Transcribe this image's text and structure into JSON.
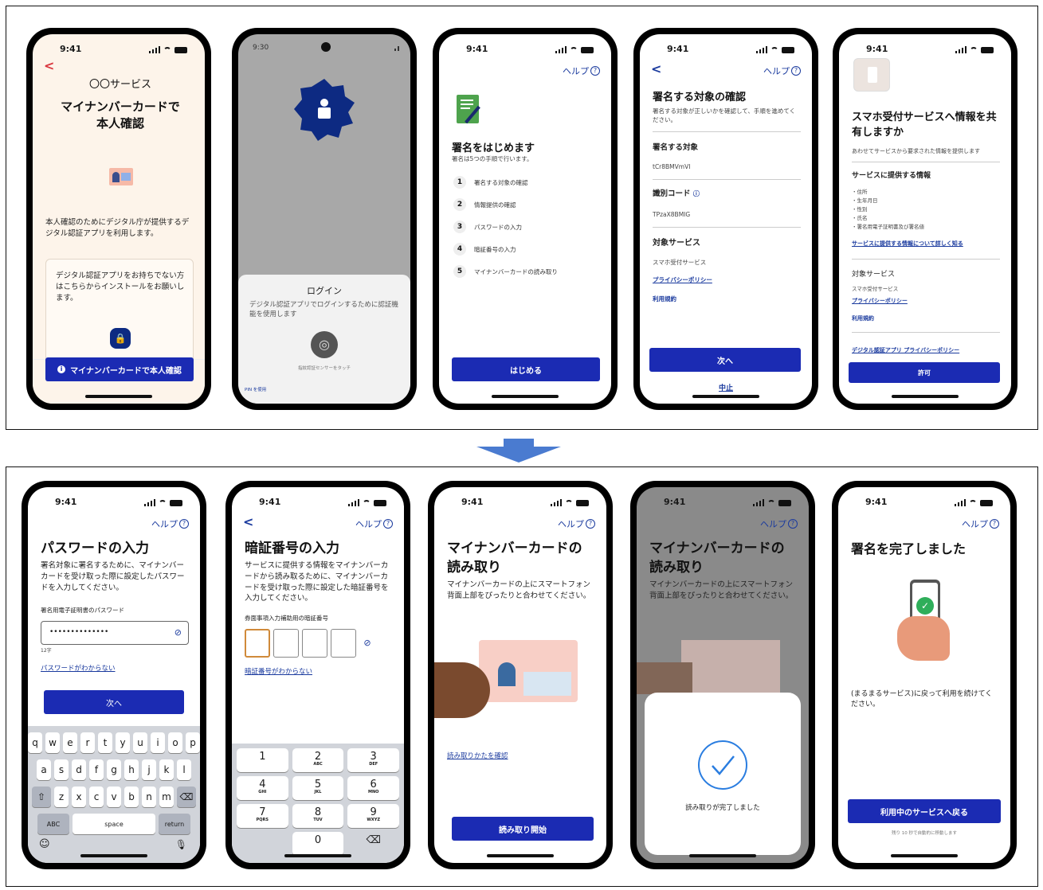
{
  "colors": {
    "primary": "#1b2bb3",
    "arrow": "#4a7bd0"
  },
  "s1": {
    "time": "9:41",
    "back": "<",
    "service": "〇〇サービス",
    "title_l1": "マイナンバーカードで",
    "title_l2": "本人確認",
    "desc": "本人確認のためにデジタル庁が提供するデジタル認証アプリを利用します。",
    "install_text": "デジタル認証アプリをお持ちでない方はこちらからインストールをお願いします。",
    "button": "マイナンバーカードで本人確認"
  },
  "s2": {
    "time": "9:30",
    "sheet_title": "ログイン",
    "sheet_desc": "デジタル認証アプリでログインするために認証機能を使用します",
    "sensor_text": "指紋認証センサーをタッチ",
    "pin": "PIN を使用"
  },
  "s3": {
    "time": "9:41",
    "help": "ヘルプ",
    "title": "署名をはじめます",
    "subtitle": "署名は5つの手順で行います。",
    "steps": [
      {
        "n": "1",
        "label": "署名する対象の確認"
      },
      {
        "n": "2",
        "label": "情報提供の確認"
      },
      {
        "n": "3",
        "label": "パスワードの入力"
      },
      {
        "n": "4",
        "label": "暗証番号の入力"
      },
      {
        "n": "5",
        "label": "マイナンバーカードの読み取り"
      }
    ],
    "button": "はじめる"
  },
  "s4": {
    "time": "9:41",
    "help": "ヘルプ",
    "back": "<",
    "title": "署名する対象の確認",
    "desc": "署名する対象が正しいかを確認して、手順を進めてください。",
    "target_label": "署名する対象",
    "target_value": "tCr8BMVmVI",
    "code_label": "識別コード",
    "code_value": "TPzaX8BMIG",
    "service_label": "対象サービス",
    "service_value": "スマホ受付サービス",
    "privacy_link": "プライバシーポリシー",
    "terms_link": "利用規約",
    "button": "次へ",
    "cancel": "中止"
  },
  "s5": {
    "time": "9:41",
    "help": "ヘルプ",
    "title": "スマホ受付サービスへ情報を共有しますか",
    "desc": "あわせてサービスから要求された情報を提供します",
    "info_heading": "サービスに提供する情報",
    "info_items": [
      "・住所",
      "・生年月日",
      "・性別",
      "・氏名",
      "・署名用電子証明書及び署名値"
    ],
    "info_link": "サービスに提供する情報について詳しく知る",
    "service_heading": "対象サービス",
    "service_value": "スマホ受付サービス",
    "privacy_link": "プライバシーポリシー",
    "terms_link": "利用規約",
    "app_privacy_link": "デジタル認証アプリ プライバシーポリシー",
    "button": "許可"
  },
  "s6": {
    "time": "9:41",
    "help": "ヘルプ",
    "title": "パスワードの入力",
    "desc": "署名対象に署名するために、マイナンバーカードを受け取った際に設定したパスワードを入力してください。",
    "field_label": "署名用電子証明書のパスワード",
    "field_value": "••••••••••••••",
    "char_count": "12字",
    "forgot_link": "パスワードがわからない",
    "button": "次へ",
    "kb_row1": [
      "q",
      "w",
      "e",
      "r",
      "t",
      "y",
      "u",
      "i",
      "o",
      "p"
    ],
    "kb_row2": [
      "a",
      "s",
      "d",
      "f",
      "g",
      "h",
      "j",
      "k",
      "l"
    ],
    "kb_row3": [
      "z",
      "x",
      "c",
      "v",
      "b",
      "n",
      "m"
    ],
    "kb_abc": "ABC",
    "kb_space": "space",
    "kb_return": "return"
  },
  "s7": {
    "time": "9:41",
    "help": "ヘルプ",
    "back": "<",
    "title": "暗証番号の入力",
    "desc": "サービスに提供する情報をマイナンバーカードから読み取るために、マイナンバーカードを受け取った際に設定した暗証番号を入力してください。",
    "field_label": "券面事項入力補助用の暗証番号",
    "forgot_link": "暗証番号がわからない",
    "keys": [
      [
        {
          "d": "1",
          "l": ""
        },
        {
          "d": "2",
          "l": "ABC"
        },
        {
          "d": "3",
          "l": "DEF"
        }
      ],
      [
        {
          "d": "4",
          "l": "GHI"
        },
        {
          "d": "5",
          "l": "JKL"
        },
        {
          "d": "6",
          "l": "MNO"
        }
      ],
      [
        {
          "d": "7",
          "l": "PQRS"
        },
        {
          "d": "8",
          "l": "TUV"
        },
        {
          "d": "9",
          "l": "WXYZ"
        }
      ],
      [
        {
          "d": "",
          "l": ""
        },
        {
          "d": "0",
          "l": ""
        },
        {
          "d": "⌫",
          "l": ""
        }
      ]
    ]
  },
  "s8": {
    "time": "9:41",
    "help": "ヘルプ",
    "title_l1": "マイナンバーカードの",
    "title_l2": "読み取り",
    "desc": "マイナンバーカードの上にスマートフォン背面上部をぴったりと合わせてください。",
    "howto_link": "読み取りかたを確認",
    "button": "読み取り開始"
  },
  "s9": {
    "time": "9:41",
    "help": "ヘルプ",
    "title_l1": "マイナンバーカードの",
    "title_l2": "読み取り",
    "desc": "マイナンバーカードの上にスマートフォン背面上部をぴったりと合わせてください。",
    "done_text": "読み取りが完了しました"
  },
  "s10": {
    "time": "9:41",
    "help": "ヘルプ",
    "title": "署名を完了しました",
    "desc": "(まるまるサービス)に戻って利用を続けてください。",
    "button": "利用中のサービスへ戻る",
    "redirect": "残り 10 秒で自動的に移動します"
  }
}
